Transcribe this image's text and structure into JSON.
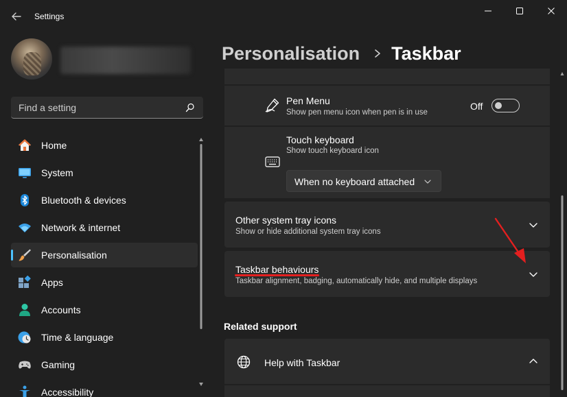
{
  "window": {
    "title": "Settings",
    "controls": [
      "minimize",
      "maximize",
      "close"
    ]
  },
  "search": {
    "placeholder": "Find a setting",
    "value": ""
  },
  "sidebar": {
    "items": [
      {
        "label": "Home",
        "icon": "home-icon"
      },
      {
        "label": "System",
        "icon": "system-icon"
      },
      {
        "label": "Bluetooth & devices",
        "icon": "bluetooth-icon"
      },
      {
        "label": "Network & internet",
        "icon": "wifi-icon"
      },
      {
        "label": "Personalisation",
        "icon": "brush-icon",
        "active": true
      },
      {
        "label": "Apps",
        "icon": "apps-icon"
      },
      {
        "label": "Accounts",
        "icon": "person-icon"
      },
      {
        "label": "Time & language",
        "icon": "clock-globe-icon"
      },
      {
        "label": "Gaming",
        "icon": "gamepad-icon"
      },
      {
        "label": "Accessibility",
        "icon": "accessibility-icon"
      }
    ]
  },
  "breadcrumb": {
    "parent": "Personalisation",
    "current": "Taskbar"
  },
  "pen_menu": {
    "title": "Pen Menu",
    "subtitle": "Show pen menu icon when pen is in use",
    "state": "Off"
  },
  "touch_keyboard": {
    "title": "Touch keyboard",
    "subtitle": "Show touch keyboard icon",
    "selected": "When no keyboard attached"
  },
  "other_tray": {
    "title": "Other system tray icons",
    "subtitle": "Show or hide additional system tray icons"
  },
  "behaviours": {
    "title": "Taskbar behaviours",
    "subtitle": "Taskbar alignment, badging, automatically hide, and multiple displays"
  },
  "related": {
    "heading": "Related support",
    "help_title": "Help with Taskbar"
  },
  "colors": {
    "background": "#202020",
    "card": "#2b2b2b",
    "accent": "#4cc2ff",
    "annotation": "#e41f1f"
  }
}
